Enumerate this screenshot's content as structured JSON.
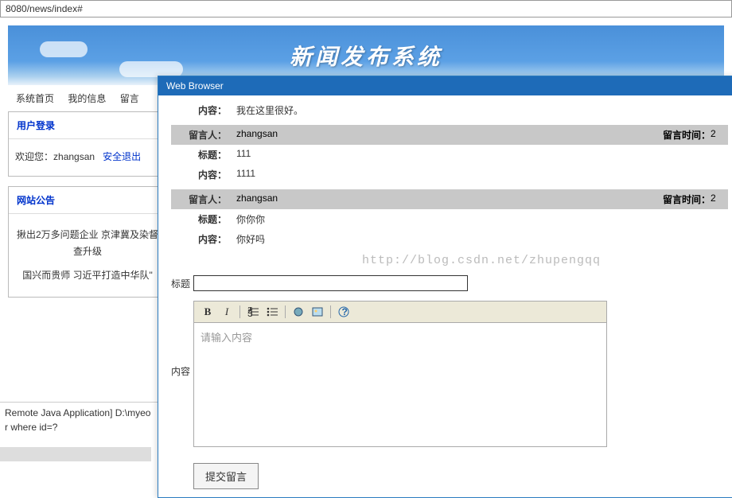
{
  "address": "8080/news/index#",
  "banner": {
    "title": "新闻发布系统"
  },
  "nav": {
    "home": "系统首页",
    "myinfo": "我的信息",
    "msg": "留言"
  },
  "login_panel": {
    "title": "用户登录",
    "welcome_prefix": "欢迎您：",
    "username": "zhangsan",
    "logout": "安全退出"
  },
  "notice_panel": {
    "title": "网站公告",
    "items": [
      "揪出2万多问题企业 京津冀及染督查升级",
      "国兴而贵师 习近平打造中华队\""
    ]
  },
  "bottom": {
    "line1": "Remote Java Application] D:\\myeo",
    "line2": "r where id=?"
  },
  "wb": {
    "title": "Web Browser",
    "labels": {
      "content": "内容：",
      "person": "留言人：",
      "title": "标题：",
      "time": "留言时间："
    },
    "top_content": "我在这里很好。",
    "messages": [
      {
        "person": "zhangsan",
        "time": "2",
        "title": "111",
        "content": "1111"
      },
      {
        "person": "zhangsan",
        "time": "2",
        "title": "你你你",
        "content": "你好吗"
      }
    ],
    "watermark": "http://blog.csdn.net/zhupengqq",
    "form": {
      "title_label": "标题",
      "content_label": "内容",
      "placeholder": "请输入内容",
      "submit": "提交留言"
    },
    "toolbar": {
      "bold": "B",
      "italic": "I",
      "ol": "ol-icon",
      "ul": "ul-icon",
      "link": "link-icon",
      "image": "image-icon",
      "help": "?"
    }
  }
}
